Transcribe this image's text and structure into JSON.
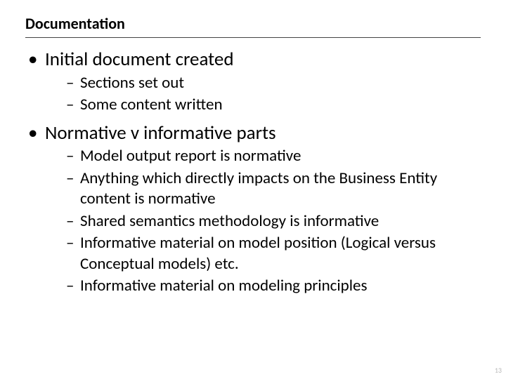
{
  "title": "Documentation",
  "bullets": [
    {
      "text": "Initial document created",
      "sub": [
        "Sections set out",
        "Some content written"
      ]
    },
    {
      "text": "Normative v informative parts",
      "sub": [
        "Model output report is normative",
        "Anything which directly impacts on the Business Entity content is normative",
        "Shared semantics methodology is informative",
        "Informative material on model position (Logical versus Conceptual models) etc.",
        "Informative material on modeling principles"
      ]
    }
  ],
  "page_number": "13"
}
